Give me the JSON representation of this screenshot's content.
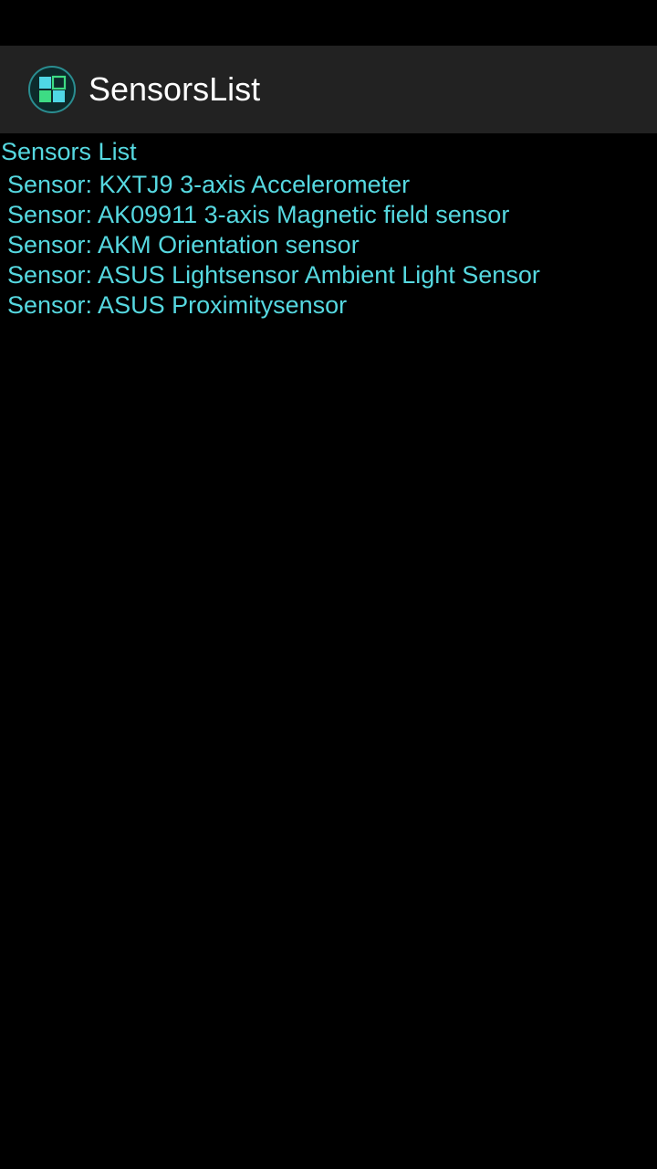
{
  "action_bar": {
    "title": "SensorsList",
    "icon": "app-grid-icon"
  },
  "content": {
    "header": "Sensors List",
    "sensors": [
      "Sensor: KXTJ9 3-axis Accelerometer",
      "Sensor: AK09911 3-axis Magnetic field sensor",
      "Sensor: AKM Orientation sensor",
      "Sensor: ASUS Lightsensor Ambient Light Sensor",
      "Sensor: ASUS Proximitysensor"
    ]
  },
  "colors": {
    "background": "#000000",
    "action_bar": "#222222",
    "title_text": "#ffffff",
    "accent_text": "#56d8e0",
    "icon_green": "#3ddc84",
    "icon_cyan": "#4fd7e6",
    "icon_ring": "#1a5b5e"
  }
}
